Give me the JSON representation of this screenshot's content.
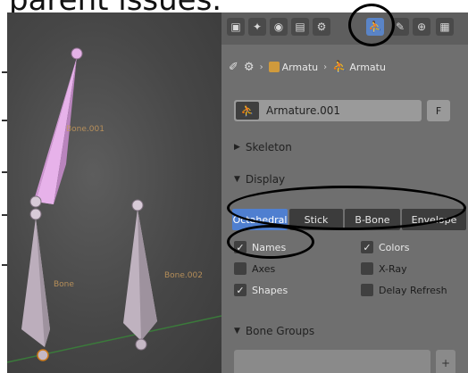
{
  "caption": "parent issues.",
  "viewport": {
    "bone_labels": [
      "Bone.001",
      "Bone",
      "Bone.002"
    ],
    "colors": {
      "selected_bone": "#e3a8e6",
      "bone": "#bfb2bf",
      "label": "#c89a5c"
    }
  },
  "properties": {
    "tabs": [
      "render-icon",
      "scene-icon",
      "world-icon",
      "object-icon",
      "armature-data-icon",
      "bone-icon",
      "constraint-icon",
      "modifier-icon"
    ],
    "context": {
      "chip1": "Armatu",
      "chip2": "Armatu"
    },
    "name_field": {
      "value": "Armature.001",
      "fake_user_label": "F"
    },
    "skeleton_label": "Skeleton",
    "display_label": "Display",
    "display_modes": [
      "Octahedral",
      "Stick",
      "B-Bone",
      "Envelope"
    ],
    "display_active": "Octahedral",
    "options": {
      "names": "Names",
      "colors": "Colors",
      "axes": "Axes",
      "xray": "X-Ray",
      "shapes": "Shapes",
      "delay_refresh": "Delay Refresh"
    },
    "bone_groups_label": "Bone Groups"
  },
  "accent": "#4f7fd0"
}
